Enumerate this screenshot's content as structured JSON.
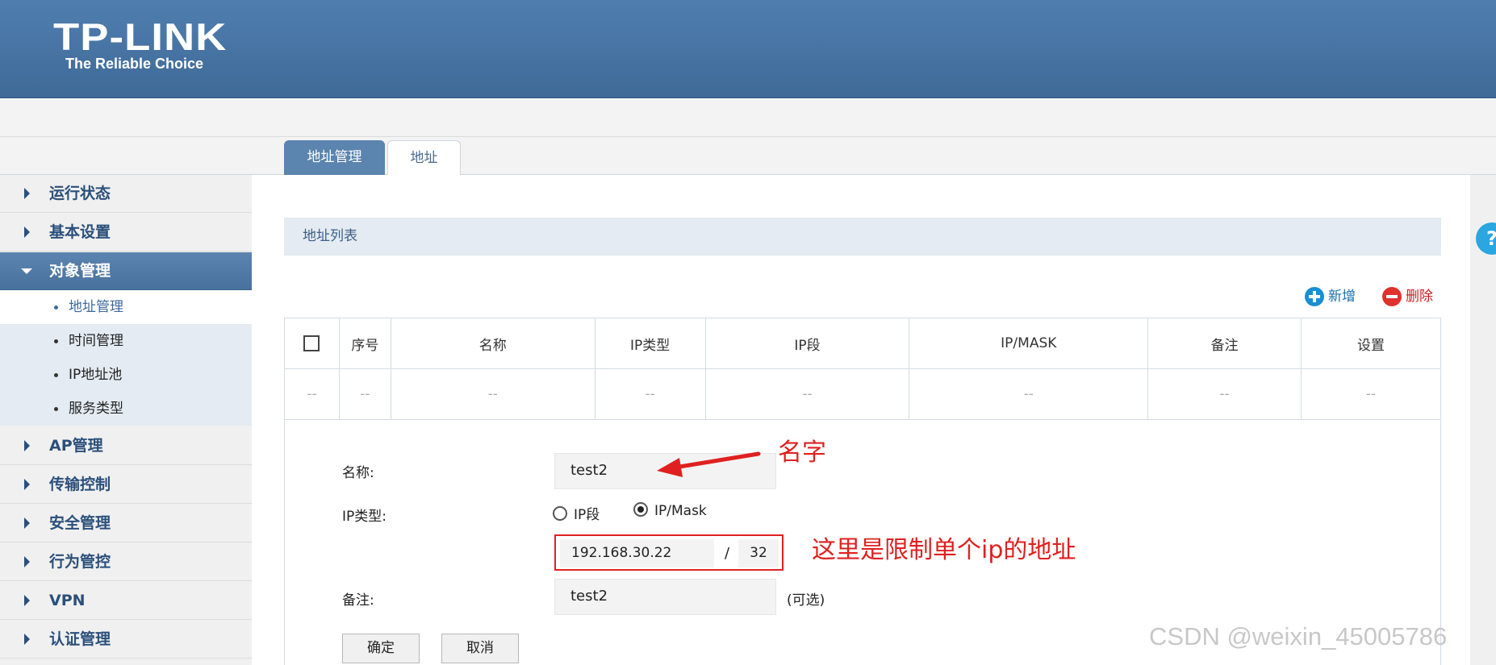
{
  "header": {
    "logo": "TP-LINK",
    "tagline": "The Reliable Choice"
  },
  "tabs": [
    {
      "label": "地址管理",
      "active": true
    },
    {
      "label": "地址",
      "active": false
    }
  ],
  "sidebar": {
    "items": [
      {
        "label": "运行状态"
      },
      {
        "label": "基本设置"
      },
      {
        "label": "对象管理",
        "expanded": true
      },
      {
        "label": "AP管理"
      },
      {
        "label": "传输控制"
      },
      {
        "label": "安全管理"
      },
      {
        "label": "行为管控"
      },
      {
        "label": "VPN"
      },
      {
        "label": "认证管理"
      }
    ],
    "sub_items": [
      {
        "label": "地址管理",
        "selected": true
      },
      {
        "label": "时间管理"
      },
      {
        "label": "IP地址池"
      },
      {
        "label": "服务类型"
      }
    ]
  },
  "main": {
    "list_title": "地址列表",
    "toolbar": {
      "add_label": "新增",
      "delete_label": "删除"
    },
    "table": {
      "columns": [
        "序号",
        "名称",
        "IP类型",
        "IP段",
        "IP/MASK",
        "备注",
        "设置"
      ],
      "rows": [
        [
          "--",
          "--",
          "--",
          "--",
          "--",
          "--",
          "--",
          "--"
        ]
      ]
    },
    "form": {
      "name_label": "名称:",
      "name_value": "test2",
      "ip_type_label": "IP类型:",
      "ip_type_options": [
        "IP段",
        "IP/Mask"
      ],
      "ip_type_selected": "IP/Mask",
      "ip_value": "192.168.30.22",
      "slash": "/",
      "mask_value": "32",
      "remark_label": "备注:",
      "remark_value": "test2",
      "remark_hint": "(可选)",
      "confirm_label": "确定",
      "cancel_label": "取消"
    }
  },
  "annotations": {
    "name_note": "名字",
    "ip_note": "这里是限制单个ip的地址"
  },
  "help_icon": "?",
  "watermark": "CSDN @weixin_45005786",
  "colors": {
    "header": "#4a77a6",
    "accent_blue": "#2b4f7a",
    "annotation_red": "#e02020"
  }
}
